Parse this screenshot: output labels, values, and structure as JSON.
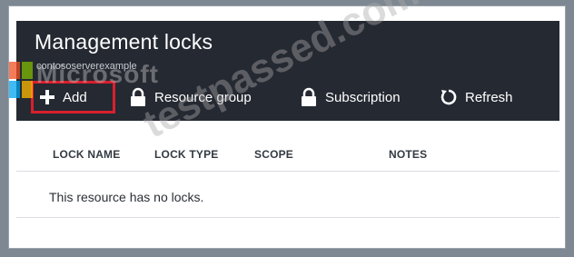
{
  "blade": {
    "title": "Management locks",
    "subtitle": "contososerverexample"
  },
  "toolbar": {
    "add_label": "Add",
    "resource_group_label": "Resource group",
    "subscription_label": "Subscription",
    "refresh_label": "Refresh",
    "add_highlight_color": "#d9202d"
  },
  "table": {
    "columns": [
      "LOCK NAME",
      "LOCK TYPE",
      "SCOPE",
      "NOTES"
    ],
    "empty_message": "This resource has no locks."
  },
  "watermark": {
    "brand": "Microsoft",
    "site": "testpassed.com"
  },
  "colors": {
    "header_bg": "#252932",
    "frame_bg": "#7d8892"
  },
  "icons": [
    "plus-icon",
    "lock-icon",
    "lock-icon",
    "refresh-icon"
  ]
}
